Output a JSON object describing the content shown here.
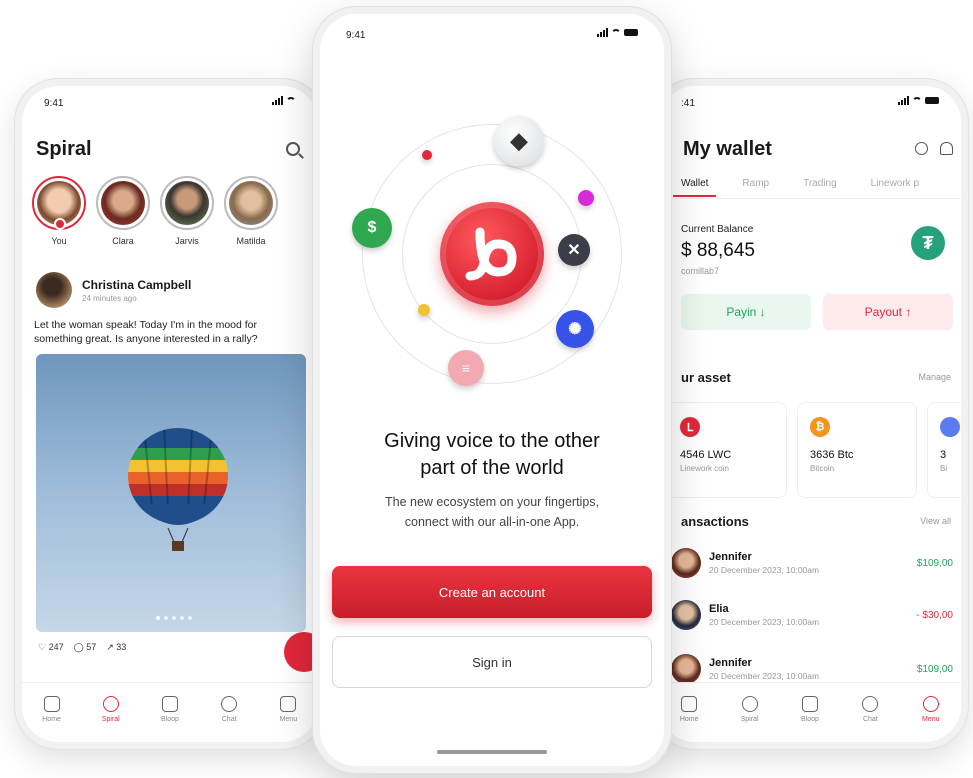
{
  "status": {
    "time": "9:41",
    "time_left": "9:41",
    "time_right": ":41"
  },
  "colors": {
    "brand_red": "#e0283b",
    "positive_green": "#21a35a",
    "tether_green": "#26a17b"
  },
  "spiral_screen": {
    "title": "Spiral",
    "stories": [
      {
        "name": "You"
      },
      {
        "name": "Clara"
      },
      {
        "name": "Jarvis"
      },
      {
        "name": "Matilda"
      }
    ],
    "post": {
      "author": "Christina Campbell",
      "time": "24 minutes ago",
      "text": "Let the woman speak! Today I'm in the mood for something great. Is anyone interested in a rally?",
      "likes": "247",
      "comments": "57",
      "shares": "33"
    },
    "tabs": [
      {
        "label": "Home",
        "icon": "home-icon"
      },
      {
        "label": "Spiral",
        "icon": "spiral-icon"
      },
      {
        "label": "Bloop",
        "icon": "bloop-icon"
      },
      {
        "label": "Chat",
        "icon": "chat-icon"
      },
      {
        "label": "Menu",
        "icon": "menu-icon"
      }
    ]
  },
  "onboarding_screen": {
    "headline_line1": "Giving voice to the other",
    "headline_line2": "part of the world",
    "subline_line1": "The new ecosystem on your fingertips,",
    "subline_line2": "connect with our all-in-one App.",
    "create_account": "Create an account",
    "sign_in": "Sign in",
    "coins": [
      "ethereum-coin",
      "usdc-coin",
      "xrp-coin",
      "cardano-coin",
      "stacked-coin"
    ]
  },
  "wallet_screen": {
    "title": "My wallet",
    "tabs": [
      "Wallet",
      "Ramp",
      "Trading",
      "Linework p"
    ],
    "balance_label": "Current Balance",
    "balance_value": "$ 88,645",
    "username": "comillab7",
    "tether_symbol": "₮",
    "payin": "Payin ↓",
    "payout": "Payout ↑",
    "asset_title": "ur asset",
    "asset_manage": "Manage",
    "assets": [
      {
        "amount": "4546 LWC",
        "name": "Linework coin",
        "symbol": "ᒪ"
      },
      {
        "amount": "3636 Btc",
        "name": "Bitcoin",
        "symbol": "₿"
      },
      {
        "amount": "3",
        "name": "Bi",
        "symbol": ""
      }
    ],
    "tx_title": "ansactions",
    "tx_link": "View all",
    "transactions": [
      {
        "name": "Jennifer",
        "date": "20 December 2023, 10:00am",
        "amount": "$109,00"
      },
      {
        "name": "Elia",
        "date": "20 December 2023, 10:00am",
        "amount": "- $30,00"
      },
      {
        "name": "Jennifer",
        "date": "20 December 2023, 10:00am",
        "amount": "$109,00"
      }
    ],
    "tabs_bottom": [
      {
        "label": "Home"
      },
      {
        "label": "Spiral"
      },
      {
        "label": "Bloop"
      },
      {
        "label": "Chat"
      },
      {
        "label": "Menu"
      }
    ]
  }
}
